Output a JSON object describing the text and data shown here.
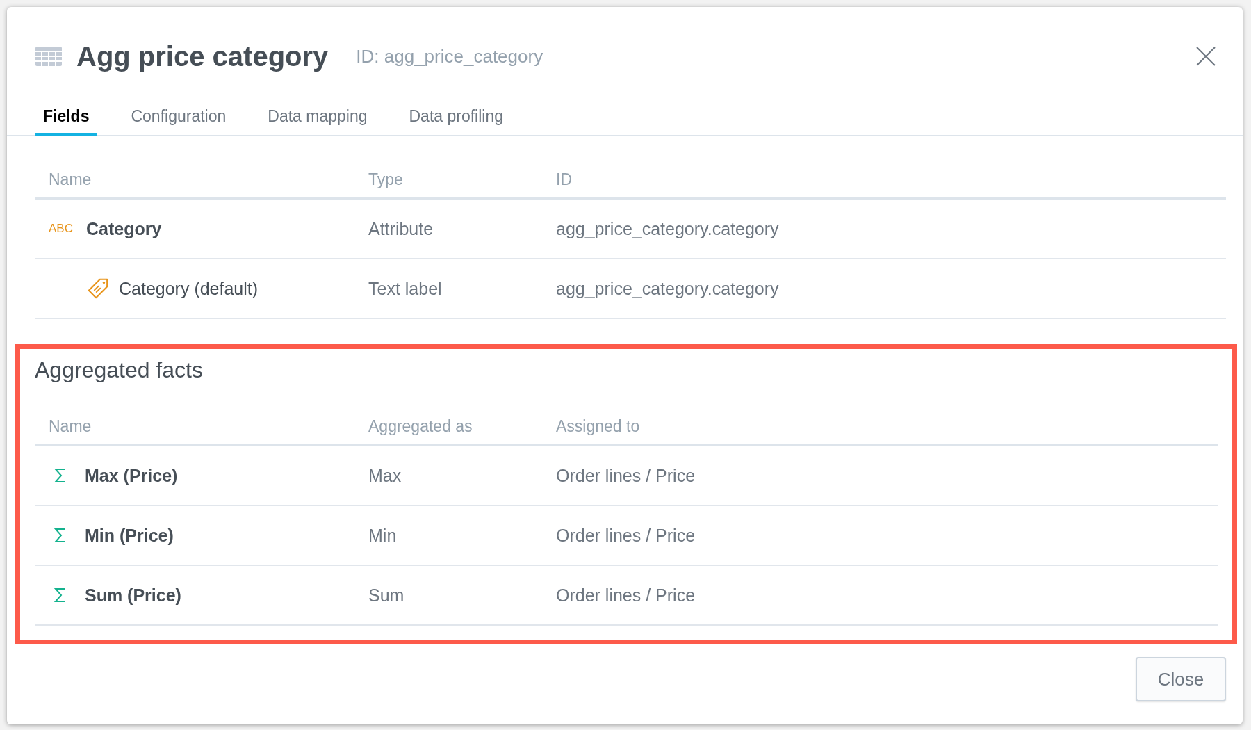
{
  "dialog": {
    "title": "Agg price category",
    "id_text": "ID: agg_price_category",
    "close_label": "Close"
  },
  "tabs": [
    {
      "label": "Fields",
      "selected": true
    },
    {
      "label": "Configuration",
      "selected": false
    },
    {
      "label": "Data mapping",
      "selected": false
    },
    {
      "label": "Data profiling",
      "selected": false
    }
  ],
  "fields_table": {
    "columns": [
      "Name",
      "Type",
      "ID"
    ],
    "rows": [
      {
        "kind": "attribute",
        "type_icon": "ABC",
        "name": "Category",
        "type": "Attribute",
        "id": "agg_price_category.category",
        "children": [
          {
            "kind": "label",
            "name": "Category (default)",
            "type": "Text label",
            "id": "agg_price_category.category"
          }
        ]
      }
    ]
  },
  "aggregated_facts": {
    "title": "Aggregated facts",
    "highlighted": true,
    "columns": [
      "Name",
      "Aggregated as",
      "Assigned to"
    ],
    "rows": [
      {
        "kind": "fact",
        "name": "Max (Price)",
        "aggregation": "Max",
        "assigned_to": "Order lines / Price"
      },
      {
        "kind": "fact",
        "name": "Min (Price)",
        "aggregation": "Min",
        "assigned_to": "Order lines / Price"
      },
      {
        "kind": "fact",
        "name": "Sum (Price)",
        "aggregation": "Sum",
        "assigned_to": "Order lines / Price"
      }
    ]
  }
}
